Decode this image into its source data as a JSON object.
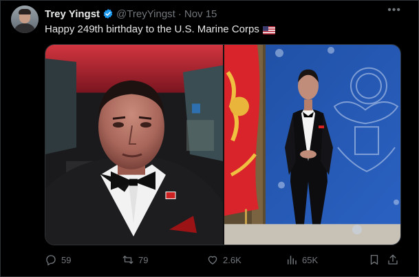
{
  "tweet": {
    "author_name": "Trey Yingst",
    "handle": "@TreyYingst",
    "separator": "·",
    "date": "Nov 15",
    "text": "Happy 249th birthday to the U.S. Marine Corps",
    "more_icon": "more-horizontal-icon",
    "verified_color": "#1d9bf0"
  },
  "actions": {
    "replies": "59",
    "retweets": "79",
    "likes": "2.6K",
    "views": "65K"
  }
}
